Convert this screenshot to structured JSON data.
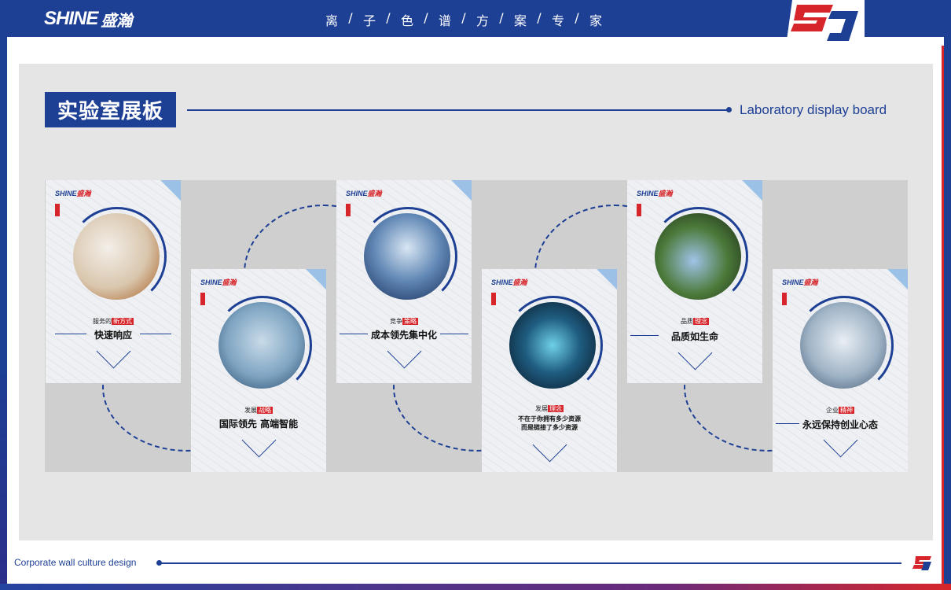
{
  "header": {
    "brand_en": "SHINE",
    "brand_cn": "盛瀚",
    "tagline": [
      "离",
      "/",
      "子",
      "/",
      "色",
      "/",
      "谱",
      "/",
      "方",
      "/",
      "案",
      "/",
      "专",
      "/",
      "家"
    ]
  },
  "section": {
    "title": "实验室展板",
    "title_en": "Laboratory display board"
  },
  "boards": [
    {
      "logo_en": "SHINE",
      "logo_cn": "盛瀚",
      "kicker_a": "服务的",
      "kicker_b": "新方式",
      "title": "快速响应"
    },
    {
      "logo_en": "SHINE",
      "logo_cn": "盛瀚",
      "kicker_a": "发展",
      "kicker_b": "战略",
      "title": "国际领先 高端智能"
    },
    {
      "logo_en": "SHINE",
      "logo_cn": "盛瀚",
      "kicker_a": "竞争",
      "kicker_b": "策略",
      "title": "成本领先集中化"
    },
    {
      "logo_en": "SHINE",
      "logo_cn": "盛瀚",
      "kicker_a": "发展",
      "kicker_b": "理念",
      "title_l1": "不在于你拥有多少资源",
      "title_l2": "而是链接了多少资源"
    },
    {
      "logo_en": "SHINE",
      "logo_cn": "盛瀚",
      "kicker_a": "品质",
      "kicker_b": "理念",
      "title": "品质如生命"
    },
    {
      "logo_en": "SHINE",
      "logo_cn": "盛瀚",
      "kicker_a": "企业",
      "kicker_b": "精神",
      "title": "永远保持创业心态"
    }
  ],
  "footer": {
    "text": "Corporate wall culture design"
  },
  "colors": {
    "brand_blue": "#1d3f94",
    "brand_red": "#d7262b",
    "panel_gray": "#e5e5e5"
  }
}
